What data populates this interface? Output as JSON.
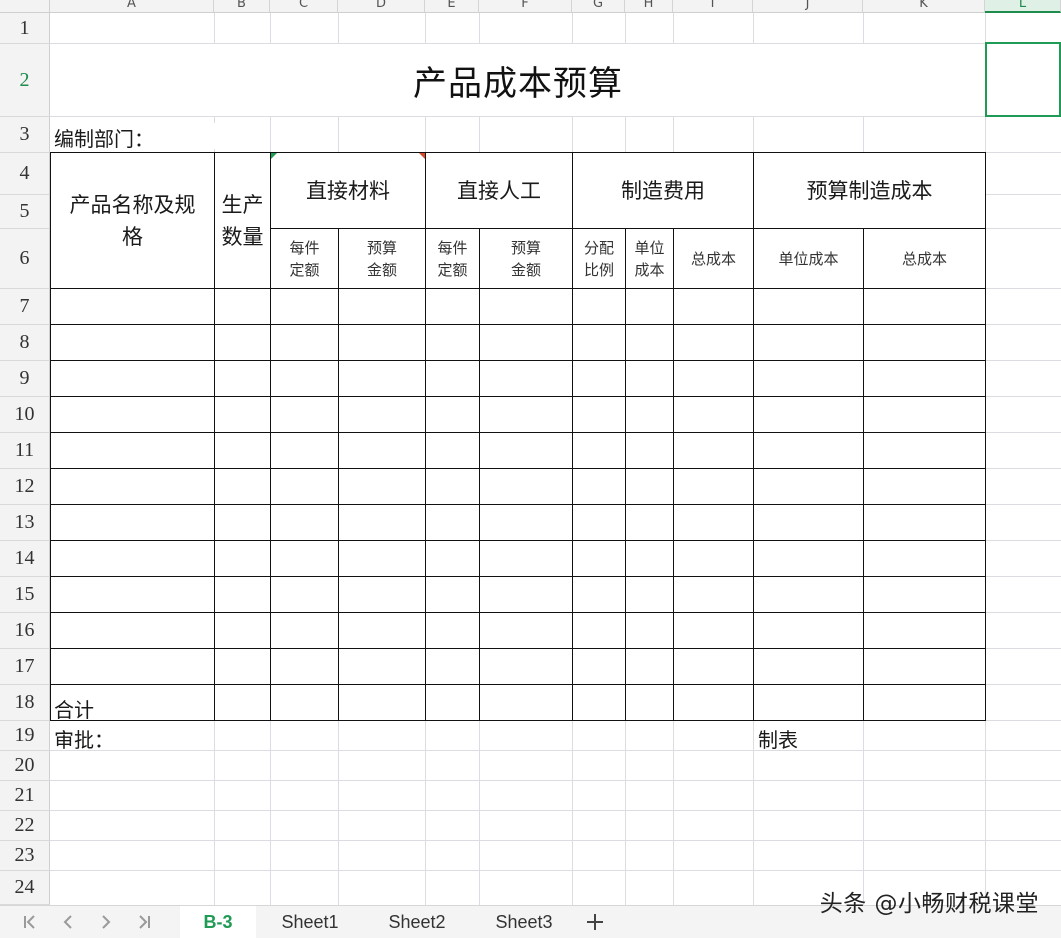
{
  "columns": [
    "A",
    "B",
    "C",
    "D",
    "E",
    "F",
    "G",
    "H",
    "I",
    "J",
    "K",
    "L"
  ],
  "selected_column": "L",
  "rows": [
    "1",
    "2",
    "3",
    "4",
    "5",
    "6",
    "7",
    "8",
    "9",
    "10",
    "11",
    "12",
    "13",
    "14",
    "15",
    "16",
    "17",
    "18",
    "19",
    "20",
    "21",
    "22",
    "23",
    "24"
  ],
  "selected_row": "2",
  "sheet": {
    "title": "产品成本预算",
    "department_label": "编制部门：",
    "headers": {
      "product_name": "产品名称及规格",
      "production_qty": "生产数量",
      "direct_material": "直接材料",
      "direct_labor": "直接人工",
      "manufacturing_cost": "制造费用",
      "budget_manufacturing_cost": "预算制造成本",
      "quota_per_piece_1": "每件定额",
      "budget_amount_1": "预算金额",
      "quota_per_piece_2": "每件定额",
      "budget_amount_2": "预算金额",
      "allocation_ratio": "分配比例",
      "unit_cost_1": "单位成本",
      "total_cost_1": "总成本",
      "unit_cost_2": "单位成本",
      "total_cost_2": "总成本"
    },
    "total_label": "合计",
    "approval_label": "审批：",
    "prepared_label": "制表"
  },
  "tabs": [
    "B-3",
    "Sheet1",
    "Sheet2",
    "Sheet3"
  ],
  "active_tab": "B-3",
  "watermark": "头条 @小畅财税课堂",
  "colors": {
    "accent": "#1f9b55",
    "grid": "#dcdde3",
    "border": "#111111"
  }
}
